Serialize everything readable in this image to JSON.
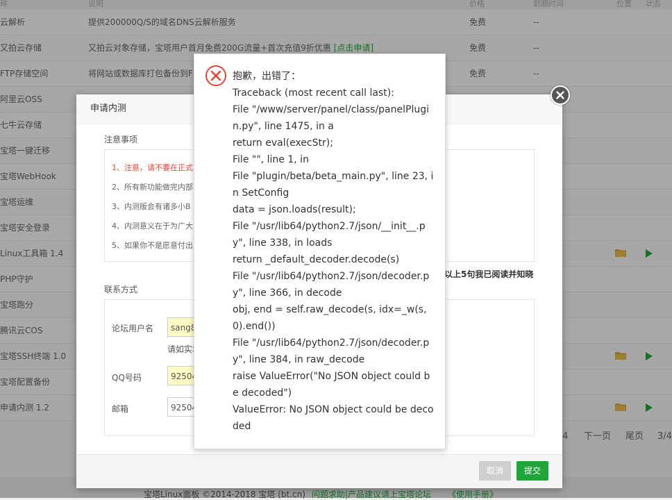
{
  "table": {
    "header": {
      "col1": "称",
      "col2": "说明",
      "col3": "价格",
      "col4": "到期时间",
      "col5": "位置",
      "col6": "状态"
    },
    "rows": [
      {
        "name": "云解析",
        "desc": "提供200000Q/S的域名DNS云解析服务",
        "price": "免费",
        "expire": "--"
      },
      {
        "name": "又拍云存储",
        "desc": "又拍云对象存储，宝塔用户首月免费200G流量+首次充值9折优惠",
        "link": "[点击申请]",
        "price": "免费",
        "expire": "--"
      },
      {
        "name": "FTP存储空间",
        "desc": "将网站或数据库打包备份到F",
        "price": "免费",
        "expire": "--"
      },
      {
        "name": "阿里云OSS"
      },
      {
        "name": "七牛云存储"
      },
      {
        "name": "宝塔一键迁移"
      },
      {
        "name": "宝塔WebHook"
      },
      {
        "name": "宝塔运维"
      },
      {
        "name": "宝塔安全登录"
      },
      {
        "name": "Linux工具箱 1.4",
        "actions": true
      },
      {
        "name": "PHP守护"
      },
      {
        "name": "宝塔跑分"
      },
      {
        "name": "腾讯云COS"
      },
      {
        "name": "宝塔SSH终端 1.0",
        "actions": true
      },
      {
        "name": "宝塔配置备份"
      },
      {
        "name": "申请内测 1.2",
        "actions": true
      }
    ]
  },
  "pager": {
    "page": "4",
    "next": "下一页",
    "last": "尾页",
    "count": "3/4"
  },
  "footer": {
    "copyright": "宝塔Linux面板 ©2014-2018 宝塔 (bt.cn)",
    "forum": "问题求助|产品建议请上宝塔论坛",
    "manual": "《使用手册》"
  },
  "dialog": {
    "title": "申请内测",
    "notice_title": "注意事项",
    "notices": [
      "1、注意，请不要在正式",
      "2、所有新功能做完内部",
      "3、内测版会有诸多小B",
      "4、内测意义在于为广大",
      "5、如果你不是愿意付出"
    ],
    "agree": "以上5句我已阅读并知晓",
    "contact_title": "联系方式",
    "forum_label": "论坛用户名",
    "forum_value": "sang8",
    "hint": "请如实填",
    "qq_label": "QQ号码",
    "qq_value": "92504",
    "email_label": "邮箱",
    "email_value": "92504",
    "cancel": "取消",
    "submit": "提交"
  },
  "error": {
    "lines": [
      "抱歉，出错了：",
      "Traceback (most recent call last):",
      "File \"/www/server/panel/class/panelPlugin.py\", line 1475, in a",
      "return eval(execStr);",
      "File \"\", line 1, in",
      "File \"plugin/beta/beta_main.py\", line 23, in SetConfig",
      "data = json.loads(result);",
      "File \"/usr/lib64/python2.7/json/__init__.py\", line 338, in loads",
      "return _default_decoder.decode(s)",
      "File \"/usr/lib64/python2.7/json/decoder.py\", line 366, in decode",
      "obj, end = self.raw_decode(s, idx=_w(s, 0).end())",
      "File \"/usr/lib64/python2.7/json/decoder.py\", line 384, in raw_decode",
      "raise ValueError(\"No JSON object could be decoded\")",
      "ValueError: No JSON object could be decoded"
    ]
  },
  "colors": {
    "accent": "#20a53a",
    "error": "#e43",
    "mask": "rgba(0,0,0,0.32)"
  }
}
